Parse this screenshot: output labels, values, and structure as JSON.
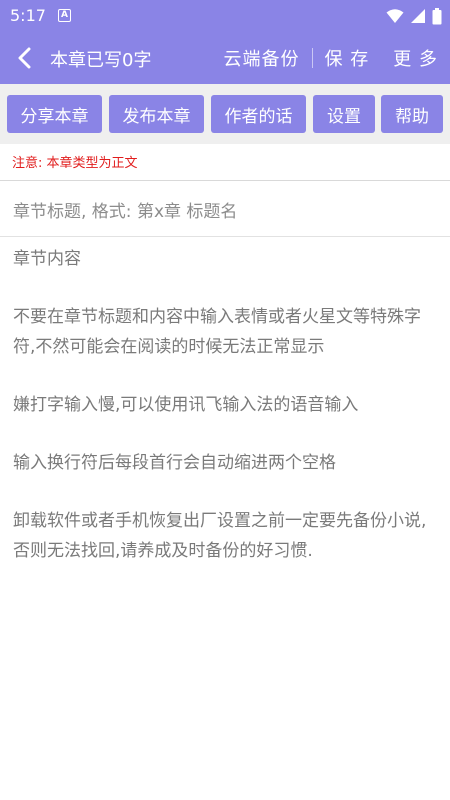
{
  "status_bar": {
    "time": "5:17",
    "notification_icon": "A",
    "icons": [
      "wifi-icon",
      "signal-icon",
      "battery-icon"
    ]
  },
  "app_bar": {
    "back_icon": "chevron-left-icon",
    "title": "本章已写0字",
    "cloud_backup": "云端备份",
    "save": "保 存",
    "more": "更 多"
  },
  "toolbar": {
    "share": "分享本章",
    "publish": "发布本章",
    "author_words": "作者的话",
    "settings": "设置",
    "help": "帮助"
  },
  "notice": "注意: 本章类型为正文",
  "editor": {
    "title_placeholder": "章节标题, 格式: 第x章 标题名",
    "content_placeholder": {
      "heading": "章节内容",
      "tip1": "不要在章节标题和内容中输入表情或者火星文等特殊字符,不然可能会在阅读的时候无法正常显示",
      "tip2": "嫌打字输入慢,可以使用讯飞输入法的语音输入",
      "tip3": "输入换行符后每段首行会自动缩进两个空格",
      "tip4": "卸载软件或者手机恢复出厂设置之前一定要先备份小说,否则无法找回,请养成及时备份的好习惯."
    }
  },
  "colors": {
    "primary": "#8a84e6",
    "notice": "#e11d1d",
    "toolbar_bg": "#efefef"
  }
}
